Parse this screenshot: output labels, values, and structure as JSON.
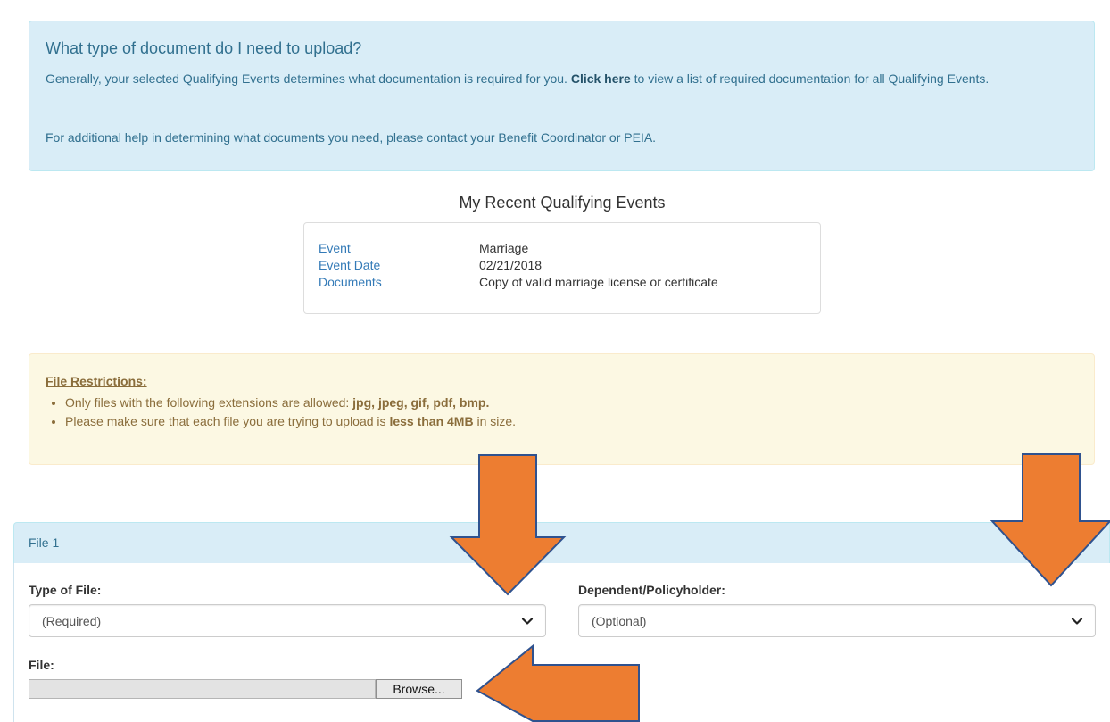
{
  "info_alert": {
    "title": "What type of document do I need to upload?",
    "para1_pre": "Generally, your selected Qualifying Events determines what documentation is required for you. ",
    "para1_link": "Click here",
    "para1_post": " to view a list of required documentation for all Qualifying Events.",
    "para2": "For additional help in determining what documents you need, please contact your Benefit Coordinator or PEIA."
  },
  "qualifying_events": {
    "heading": "My Recent Qualifying Events",
    "rows": [
      {
        "key": "Event",
        "value": "Marriage"
      },
      {
        "key": "Event Date",
        "value": "02/21/2018"
      },
      {
        "key": "Documents",
        "value": "Copy of valid marriage license or certificate"
      }
    ]
  },
  "file_restrictions": {
    "title": "File Restrictions:",
    "item1_pre": "Only files with the following extensions are allowed: ",
    "item1_bold": "jpg, jpeg, gif, pdf, bmp.",
    "item2_pre": "Please make sure that each file you are trying to upload is ",
    "item2_bold": "less than 4MB",
    "item2_post": " in size."
  },
  "file_panel": {
    "heading": "File 1",
    "type_label": "Type of File:",
    "type_value": "(Required)",
    "dependent_label": "Dependent/Policyholder:",
    "dependent_value": "(Optional)",
    "file_label": "File:",
    "browse_label": "Browse..."
  },
  "colors": {
    "info_bg": "#d9edf7",
    "info_text": "#31708f",
    "warning_bg": "#fcf8e3",
    "warning_text": "#8a6d3b",
    "arrow_fill": "#ed7d31",
    "arrow_stroke": "#2f528f"
  },
  "icons": [
    "chevron-down-icon",
    "arrow-down-icon",
    "arrow-left-icon"
  ]
}
